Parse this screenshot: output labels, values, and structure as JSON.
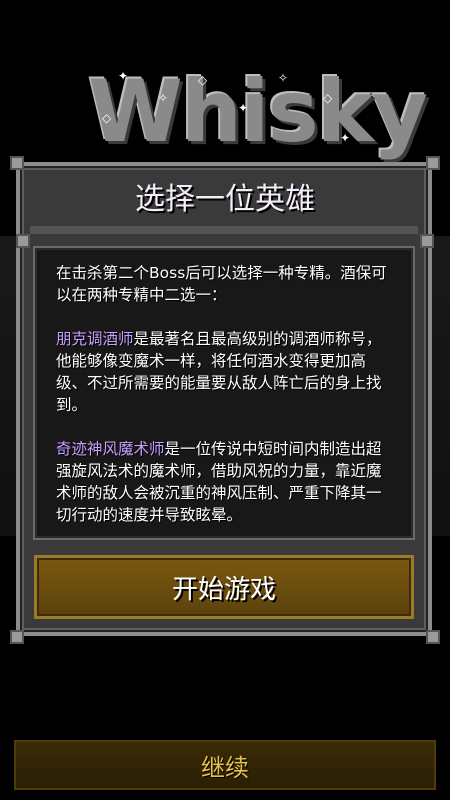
{
  "logo": {
    "text": "Whisky"
  },
  "dialog": {
    "title": "选择一位英雄",
    "intro": "在击杀第二个Boss后可以选择一种专精。酒保可以在两种专精中二选一：",
    "spec1_name": "朋克调酒师",
    "spec1_desc": "是最著名且最高级别的调酒师称号，他能够像变魔术一样，将任何酒水变得更加高级、不过所需要的能量要从敌人阵亡后的身上找到。",
    "spec2_name": "奇迹神风魔术师",
    "spec2_desc": "是一位传说中短时间内制造出超强旋风法术的魔术师，借助风祝的力量，靠近魔术师的敌人会被沉重的神风压制、严重下降其一切行动的速度并导致眩晕。",
    "start_button": "开始游戏"
  },
  "continue_button": "继续",
  "colors": {
    "highlight": "#c9a0ff",
    "start_button_bg": "#6b4c0e",
    "continue_text": "#e8c24a"
  }
}
